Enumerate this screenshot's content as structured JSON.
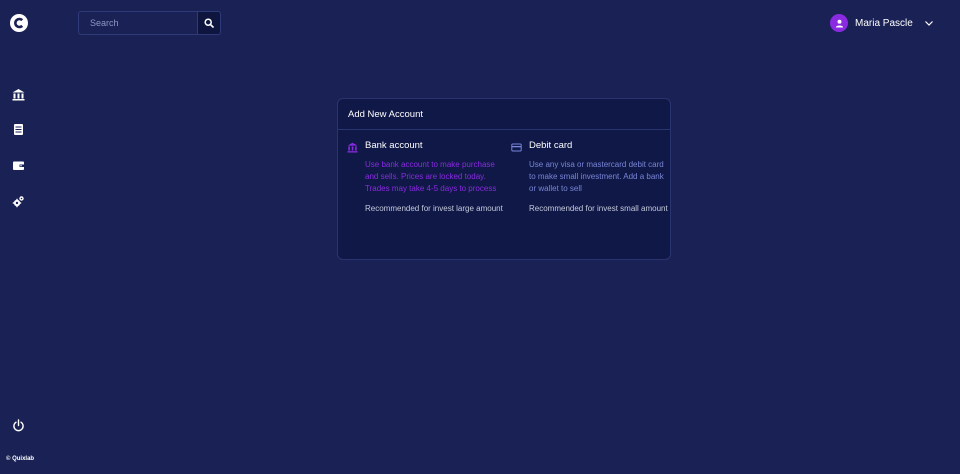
{
  "search": {
    "placeholder": "Search"
  },
  "user": {
    "name": "Maria Pascle"
  },
  "footer": {
    "copyright": "© Quixlab"
  },
  "sidebar": {
    "items": [
      {
        "icon": "bank-icon"
      },
      {
        "icon": "list-icon"
      },
      {
        "icon": "wallet-icon"
      },
      {
        "icon": "gear-icon"
      }
    ],
    "logout_icon": "power-icon"
  },
  "card": {
    "title": "Add New Account",
    "options": [
      {
        "title": "Bank account",
        "description": "Use bank account to make purchase and sells. Prices are locked today. Trades may take 4-5 days to process",
        "recommendation": "Recommended for invest large amount",
        "icon": "bank-icon"
      },
      {
        "title": "Debit card",
        "description": "Use any visa or mastercard debit card to make small investment. Add a bank or wallet to sell",
        "recommendation": "Recommended for invest small amount",
        "icon": "credit-card-icon"
      }
    ]
  },
  "colors": {
    "background": "#1a2255",
    "card": "#0f1846",
    "accent": "#8a2be2",
    "link": "#7a86d8"
  }
}
